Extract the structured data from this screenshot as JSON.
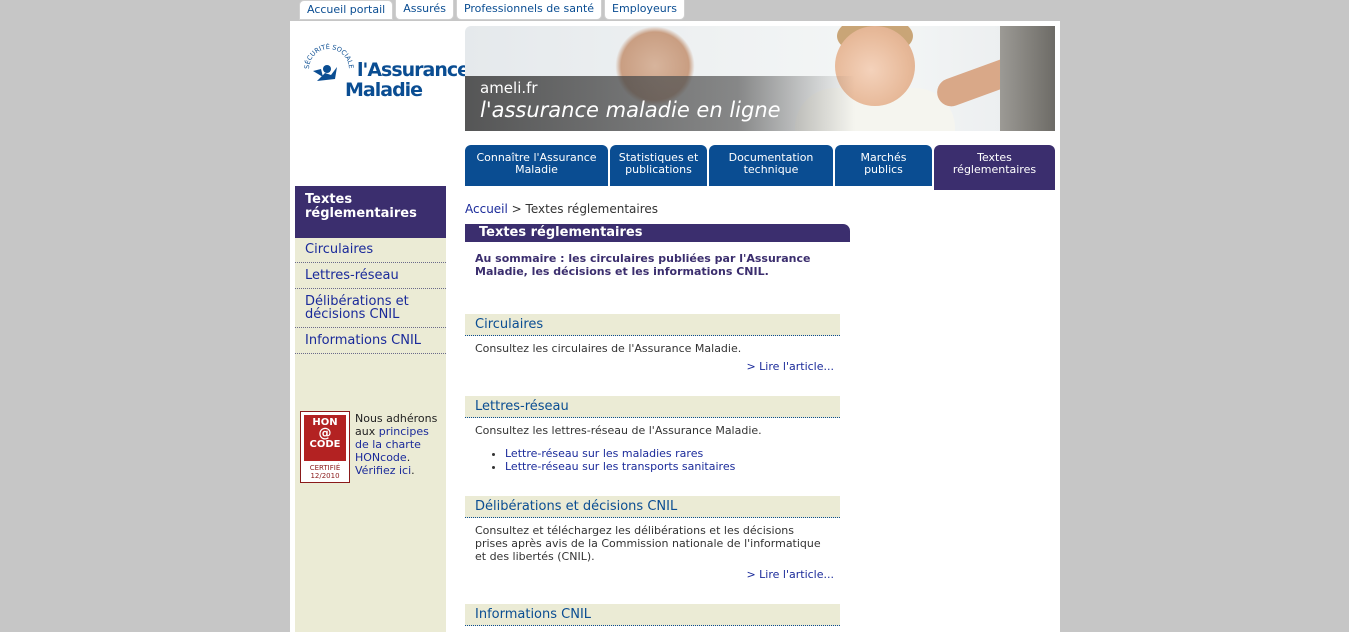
{
  "top_tabs": [
    "Accueil portail",
    "Assurés",
    "Professionnels de santé",
    "Employeurs"
  ],
  "logo": {
    "arc_text": "SÉCURITÉ SOCIALE",
    "line1": "l'Assurance",
    "line2": "Maladie"
  },
  "banner": {
    "site": "ameli.fr",
    "tagline": "l'assurance maladie en ligne"
  },
  "main_nav": [
    {
      "label": "Connaître l'Assurance Maladie"
    },
    {
      "label": "Statistiques et publications"
    },
    {
      "label": "Documentation technique"
    },
    {
      "label": "Marchés publics"
    },
    {
      "label": "Textes réglementaires"
    }
  ],
  "sidebar": {
    "title": "Textes réglementaires",
    "items": [
      "Circulaires",
      "Lettres-réseau",
      "Délibérations et décisions CNIL",
      "Informations CNIL"
    ],
    "hon": {
      "logo_top": "HON",
      "logo_mid": "@",
      "logo_bottom": "CODE",
      "cert": "CERTIFIÉ",
      "date": "12/2010",
      "text_before": "Nous adhérons aux ",
      "link1": "principes de la charte HONcode",
      "text_mid": ". ",
      "link2": "Vérifiez ici",
      "text_after": "."
    }
  },
  "breadcrumb": {
    "home": "Accueil",
    "sep": " > ",
    "current": "Textes réglementaires"
  },
  "content": {
    "title": "Textes réglementaires",
    "intro": "Au sommaire : les circulaires publiées par l'Assurance Maladie, les décisions et les informations CNIL.",
    "read_more": "> Lire l'article...",
    "sections": [
      {
        "title": "Circulaires",
        "text": "Consultez les circulaires de l'Assurance Maladie."
      },
      {
        "title": "Lettres-réseau",
        "text": "Consultez les lettres-réseau de l'Assurance Maladie.",
        "links": [
          "Lettre-réseau sur les maladies rares",
          "Lettre-réseau sur les transports sanitaires"
        ]
      },
      {
        "title": "Délibérations et décisions CNIL",
        "text": "Consultez et téléchargez les délibérations et les décisions prises après avis de la Commission nationale de l'informatique et des libertés (CNIL)."
      },
      {
        "title": "Informations CNIL"
      }
    ]
  },
  "colors": {
    "background": "#c6c6c6",
    "primary_blue": "#0a4d92",
    "active_purple": "#3b2e6e",
    "sidebar_beige": "#ebebd5"
  }
}
